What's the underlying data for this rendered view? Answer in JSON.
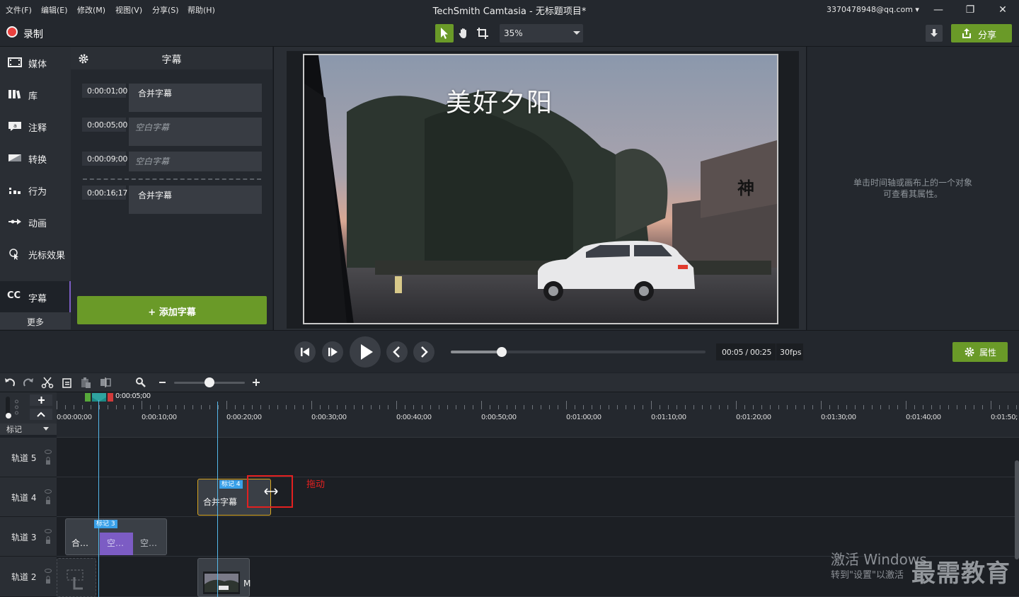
{
  "menu": [
    "文件(F)",
    "编辑(E)",
    "修改(M)",
    "视图(V)",
    "分享(S)",
    "帮助(H)"
  ],
  "app_title": "TechSmith Camtasia - 无标题项目*",
  "account": "3370478948@qq.com ▾",
  "window_controls": {
    "minimize": "—",
    "restore": "❐",
    "close": "✕"
  },
  "toolbar": {
    "record_label": "录制",
    "zoom_value": "35%",
    "share_label": "分享",
    "tools": [
      "pointer-icon",
      "hand-icon",
      "crop-icon"
    ]
  },
  "sidebar": {
    "items": [
      {
        "label": "媒体",
        "icon": "film-icon"
      },
      {
        "label": "库",
        "icon": "library-icon"
      },
      {
        "label": "注释",
        "icon": "annotation-icon"
      },
      {
        "label": "转换",
        "icon": "transition-icon"
      },
      {
        "label": "行为",
        "icon": "behavior-icon"
      },
      {
        "label": "动画",
        "icon": "animation-icon"
      },
      {
        "label": "光标效果",
        "icon": "cursor-effect-icon"
      },
      {
        "label": "字幕",
        "icon": "cc-icon"
      }
    ],
    "cc_badge": "CC",
    "more_label": "更多"
  },
  "captions": {
    "title": "字幕",
    "rows": [
      {
        "time": "0:00:01;00",
        "text": "合并字幕",
        "empty": false
      },
      {
        "time": "0:00:05;00",
        "text": "空白字幕",
        "empty": true
      },
      {
        "time": "0:00:09;00",
        "text": "空白字幕",
        "empty": true
      },
      {
        "time": "0:00:16;17",
        "text": "合并字幕",
        "empty": false
      }
    ],
    "add_label": "+  添加字幕"
  },
  "canvas": {
    "video_title": "美好夕阳",
    "sign_text": "神"
  },
  "properties": {
    "hint_line1": "单击时间轴或画布上的一个对象",
    "hint_line2": "可查看其属性。",
    "button_label": "属性"
  },
  "playback": {
    "time": "00:05 / 00:25",
    "fps": "30fps",
    "scrub_fraction": 0.2
  },
  "timeline": {
    "playhead_time": "0:00:05;00",
    "ruler_labels": [
      "0:00:00;00",
      "0:00:10;00",
      "0:00:20;00",
      "0:00:30;00",
      "0:00:40;00",
      "0:00:50;00",
      "0:01:00;00",
      "0:01:10;00",
      "0:01:20;00",
      "0:01:30;00",
      "0:01:40;00",
      "0:01:50;"
    ],
    "marker_label": "标记",
    "tracks": [
      "轨道 5",
      "轨道 4",
      "轨道 3",
      "轨道 2"
    ],
    "clip_track4": {
      "tag": "标记 4",
      "text": "合并字幕"
    },
    "clip_track3": {
      "tag": "标记 3",
      "segments": [
        "合…",
        "空…",
        "空…"
      ]
    },
    "clip_track2_label": "M"
  },
  "annotation": {
    "drag_label": "拖动"
  },
  "watermark": {
    "line1": "激活 Windows",
    "line2": "转到\"设置\"以激活",
    "brand": "最需教育"
  },
  "colors": {
    "accent_green": "#6a9a28",
    "record_red": "#e9413e",
    "playhead_blue": "#55b8ea",
    "annotation_red": "#e32020",
    "caption_purple": "#7c5cc4",
    "clip_gold": "#d8a520"
  }
}
